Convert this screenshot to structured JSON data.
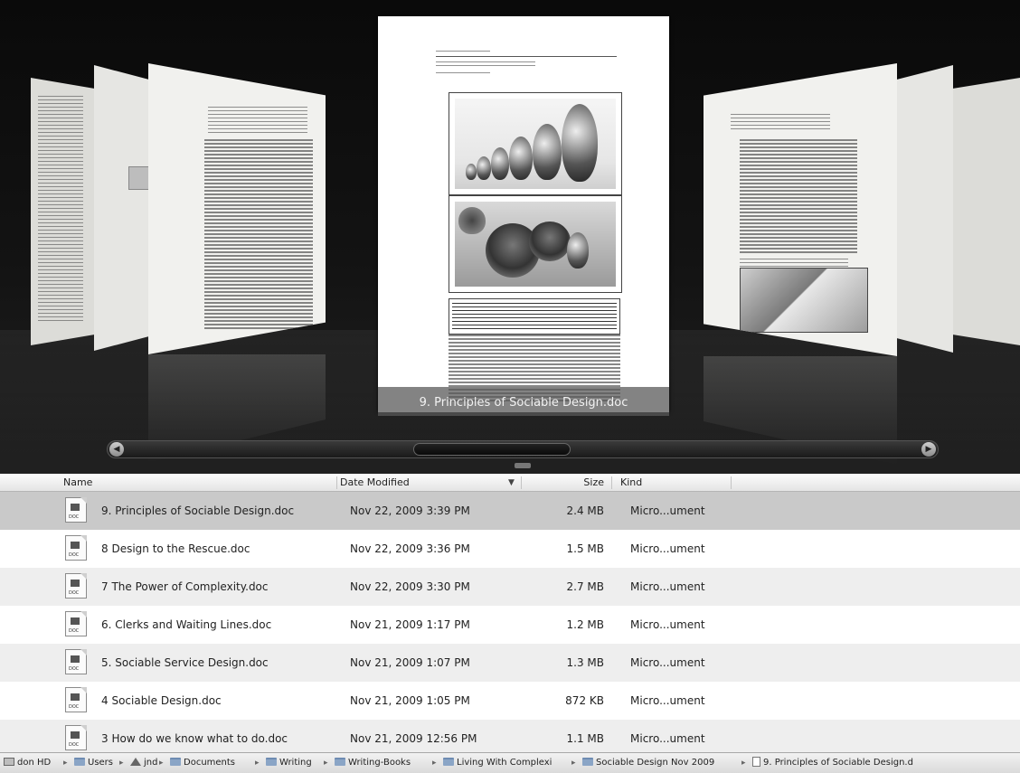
{
  "coverflow": {
    "selected_title": "9. Principles of Sociable Design.doc",
    "slider_left_arrow": "◀",
    "slider_right_arrow": "▶"
  },
  "columns": {
    "name": "Name",
    "date": "Date Modified",
    "date_sort_icon": "▼",
    "size": "Size",
    "kind": "Kind"
  },
  "files": [
    {
      "name": "9. Principles of Sociable Design.doc",
      "date": "Nov 22, 2009 3:39 PM",
      "size": "2.4 MB",
      "kind": "Micro...ument",
      "icon": "word-doc-icon"
    },
    {
      "name": "8 Design to the Rescue.doc",
      "date": "Nov 22, 2009 3:36 PM",
      "size": "1.5 MB",
      "kind": "Micro...ument",
      "icon": "word-doc-icon"
    },
    {
      "name": "7 The Power of Complexity.doc",
      "date": "Nov 22, 2009 3:30 PM",
      "size": "2.7 MB",
      "kind": "Micro...ument",
      "icon": "word-doc-icon"
    },
    {
      "name": "6. Clerks and Waiting Lines.doc",
      "date": "Nov 21, 2009 1:17 PM",
      "size": "1.2 MB",
      "kind": "Micro...ument",
      "icon": "word-doc-icon"
    },
    {
      "name": "5. Sociable Service Design.doc",
      "date": "Nov 21, 2009 1:07 PM",
      "size": "1.3 MB",
      "kind": "Micro...ument",
      "icon": "word-doc-icon"
    },
    {
      "name": "4 Sociable Design.doc",
      "date": "Nov 21, 2009 1:05 PM",
      "size": "872 KB",
      "kind": "Micro...ument",
      "icon": "word-doc-icon"
    },
    {
      "name": "3 How do we know what to do.doc",
      "date": "Nov 21, 2009 12:56 PM",
      "size": "1.1 MB",
      "kind": "Micro...ument",
      "icon": "word-doc-icon"
    }
  ],
  "doc_icon_label": "DOC",
  "path": [
    {
      "label": "don HD",
      "icon": "hard-disk-icon"
    },
    {
      "label": "Users",
      "icon": "folder-icon"
    },
    {
      "label": "jnd",
      "icon": "home-icon"
    },
    {
      "label": "Documents",
      "icon": "folder-icon"
    },
    {
      "label": "Writing",
      "icon": "folder-icon"
    },
    {
      "label": "Writing-Books",
      "icon": "folder-icon"
    },
    {
      "label": "Living With Complexi",
      "icon": "folder-icon"
    },
    {
      "label": "Sociable Design Nov 2009",
      "icon": "folder-icon"
    },
    {
      "label": "9. Principles of Sociable Design.d",
      "icon": "document-icon"
    }
  ],
  "path_separator": "▸"
}
